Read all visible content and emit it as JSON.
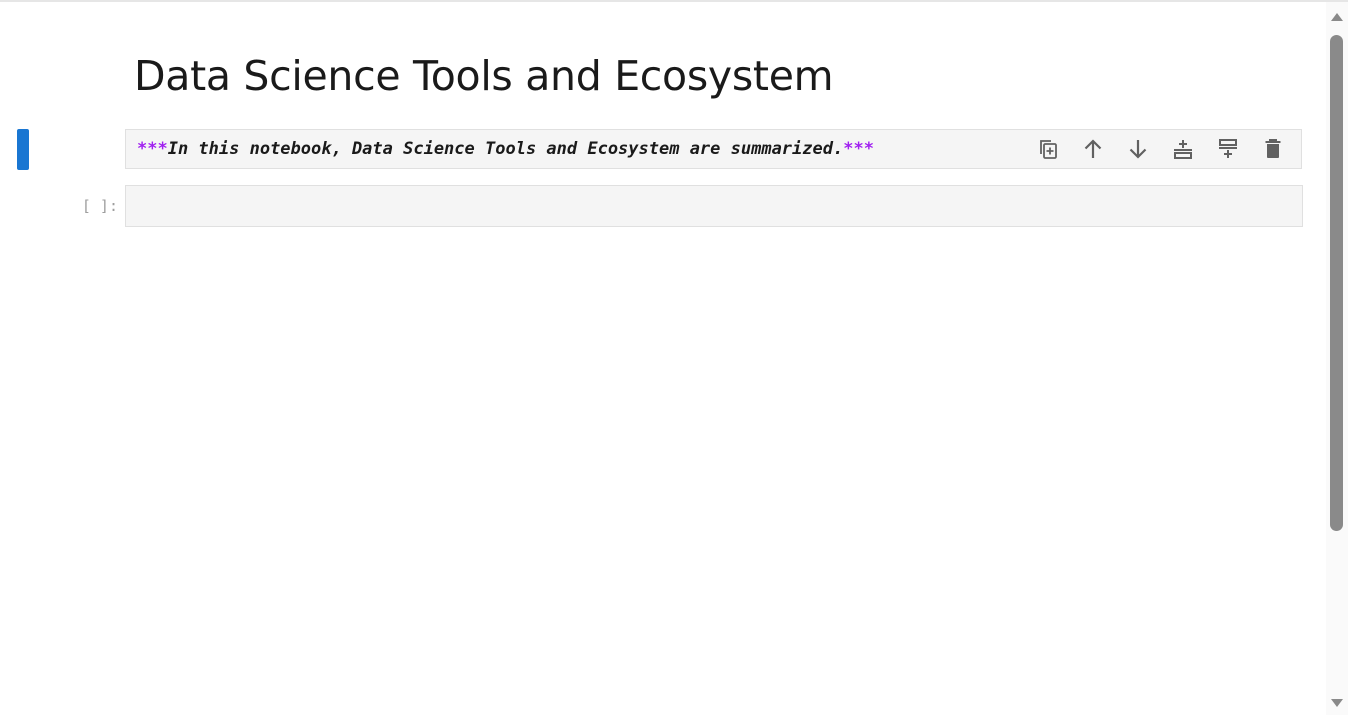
{
  "notebook": {
    "heading": "Data Science Tools and Ecosystem",
    "markdown_cell": {
      "mark_open": "***",
      "text": "In this notebook, Data Science Tools and Ecosystem are summarized.",
      "mark_close": "***"
    },
    "code_cell": {
      "prompt": "[ ]:",
      "source": ""
    }
  },
  "toolbar": {
    "icons": [
      "duplicate-icon",
      "move-up-icon",
      "move-down-icon",
      "insert-above-icon",
      "insert-below-icon",
      "delete-icon"
    ]
  },
  "colors": {
    "active_indicator": "#1976d2",
    "markdown_emphasis": "#a020f0",
    "cell_background": "#f5f5f5"
  }
}
